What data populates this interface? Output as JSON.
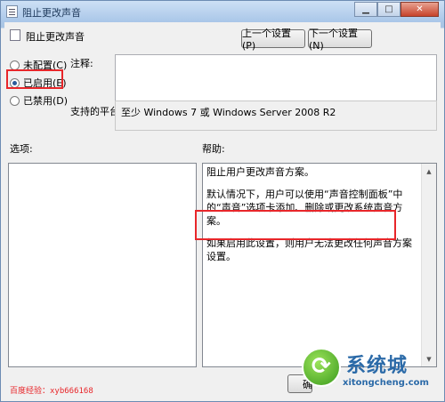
{
  "window": {
    "title": "阻止更改声音",
    "minimize_glyph": "▁",
    "maximize_glyph": "□",
    "close_glyph": "✕"
  },
  "header": {
    "policy_name": "阻止更改声音",
    "prev_button": "上一个设置(P)",
    "next_button": "下一个设置(N)"
  },
  "state": {
    "options": [
      {
        "label": "未配置(C)",
        "selected": false
      },
      {
        "label": "已启用(E)",
        "selected": true
      },
      {
        "label": "已禁用(D)",
        "selected": false
      }
    ]
  },
  "comment": {
    "label": "注释:",
    "value": ""
  },
  "platform": {
    "label": "支持的平台:",
    "value": "至少 Windows 7 或 Windows Server 2008 R2"
  },
  "options_panel": {
    "label": "选项:"
  },
  "help_panel": {
    "label": "帮助:",
    "paragraphs": [
      "阻止用户更改声音方案。",
      "默认情况下，用户可以使用“声音控制面板”中的“声音”选项卡添加、删除或更改系统声音方案。",
      "如果启用此设置，则用户无法更改任何声音方案设置。"
    ]
  },
  "footer": {
    "credit": "百度经验：xyb666168",
    "partial_button_fragment": "确"
  },
  "watermark": {
    "name": "系统城",
    "url": "xitongcheng.com"
  },
  "colors": {
    "highlight": "#e8262a",
    "titlebar": "#a9c6e8"
  }
}
